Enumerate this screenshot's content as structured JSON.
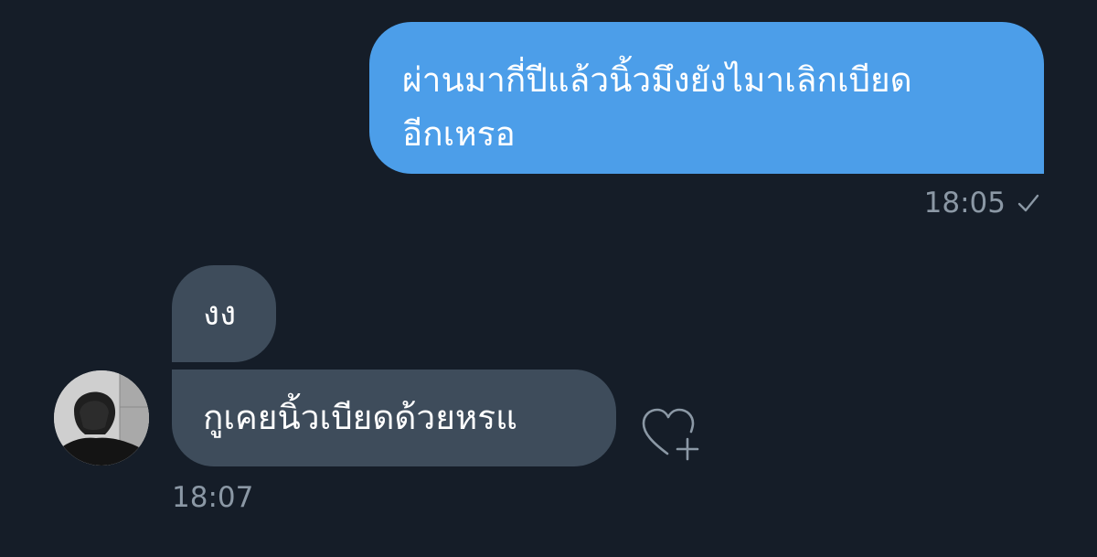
{
  "messages": [
    {
      "direction": "outgoing",
      "lines": [
        "ผ่านมากี่ปีแล้วนิ้วมึงยังไมาเลิกเบียด",
        "อีกเหรอ"
      ],
      "time": "18:05",
      "status_icon": "check-icon"
    },
    {
      "direction": "incoming",
      "text": "งง"
    },
    {
      "direction": "incoming",
      "text": "กูเคยนิ้วเบียดด้วยหรแ",
      "time": "18:07"
    }
  ],
  "icons": {
    "react": "heart-plus-icon",
    "avatar": "avatar"
  },
  "colors": {
    "background": "#151d28",
    "outgoing_bubble": "#4c9ee9",
    "incoming_bubble": "#3e4c5b",
    "meta_text": "#8b98a5"
  }
}
